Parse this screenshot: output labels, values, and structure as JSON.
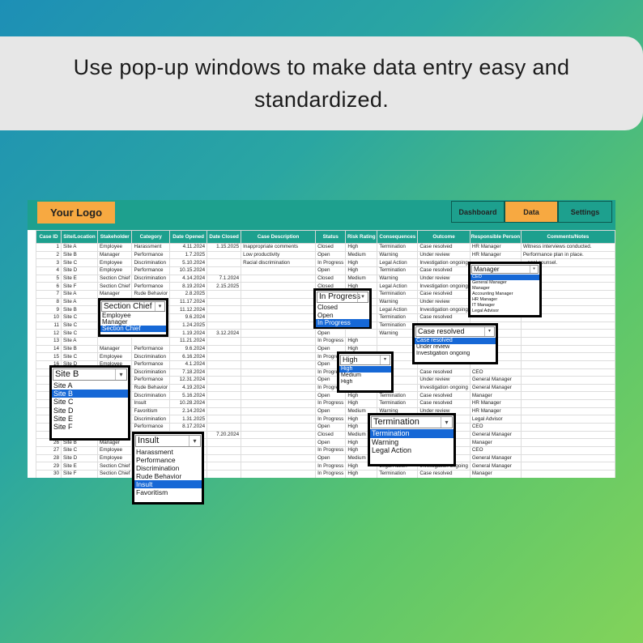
{
  "headline": {
    "line1": "Use pop-up windows to make data entry easy and",
    "line2": "standardized."
  },
  "toolbar": {
    "logo": "Your Logo",
    "tabs": [
      {
        "label": "Dashboard",
        "active": false
      },
      {
        "label": "Data",
        "active": true
      },
      {
        "label": "Settings",
        "active": false
      }
    ]
  },
  "colors": {
    "header_teal": "#1da08e",
    "accent_orange": "#f7a941",
    "highlight_blue": "#1668d6"
  },
  "table": {
    "headers": [
      "Case ID",
      "Site/Location",
      "Stakeholder",
      "Category",
      "Date Opened",
      "Date Closed",
      "Case Description",
      "Status",
      "Risk Rating",
      "Consequences",
      "Outcome",
      "Responsible Person",
      "Comments/Notes"
    ],
    "rows": [
      [
        "1",
        "Site A",
        "Employee",
        "Harassment",
        "4.11.2024",
        "1.15.2025",
        "Inappropriate comments",
        "Closed",
        "High",
        "Termination",
        "Case resolved",
        "HR Manager",
        "Witness interviews conducted."
      ],
      [
        "2",
        "Site B",
        "Manager",
        "Performance",
        "1.7.2025",
        "",
        "Low productivity",
        "Open",
        "Medium",
        "Warning",
        "Under review",
        "HR Manager",
        "Performance plan in place."
      ],
      [
        "3",
        "Site C",
        "Employee",
        "Discrimination",
        "5.10.2024",
        "",
        "Racial discrimination",
        "In Progress",
        "High",
        "Legal Action",
        "Investigation ongoing",
        "",
        "...egal counsel."
      ],
      [
        "4",
        "Site D",
        "Employee",
        "Performance",
        "10.15.2024",
        "",
        "",
        "Open",
        "High",
        "Termination",
        "Case resolved",
        "",
        ""
      ],
      [
        "5",
        "Site E",
        "Section Chief",
        "Discrimination",
        "4.14.2024",
        "7.1.2024",
        "",
        "Closed",
        "Medium",
        "Warning",
        "Under review",
        "",
        ""
      ],
      [
        "6",
        "Site F",
        "Section Chief",
        "Performance",
        "8.19.2024",
        "2.15.2025",
        "",
        "Closed",
        "High",
        "Legal Action",
        "Investigation ongoing",
        "",
        ""
      ],
      [
        "7",
        "Site A",
        "Manager",
        "Rude Behavior",
        "2.8.2025",
        "",
        "",
        "Closed",
        "",
        "Termination",
        "Case resolved",
        "",
        ""
      ],
      [
        "8",
        "Site A",
        "",
        "",
        "11.17.2024",
        "",
        "",
        "",
        "",
        "Warning",
        "Under review",
        "",
        ""
      ],
      [
        "9",
        "Site B",
        "",
        "",
        "11.12.2024",
        "",
        "",
        "",
        "",
        "Legal Action",
        "Investigation ongoing",
        "",
        ""
      ],
      [
        "10",
        "Site C",
        "",
        "",
        "9.6.2024",
        "",
        "",
        "",
        "",
        "Termination",
        "Case resolved",
        "",
        ""
      ],
      [
        "11",
        "Site C",
        "",
        "",
        "1.24.2025",
        "",
        "",
        "",
        "",
        "Termination",
        "",
        "",
        ""
      ],
      [
        "12",
        "Site C",
        "",
        "",
        "1.19.2024",
        "3.12.2024",
        "",
        "Open",
        "",
        "Warning",
        "",
        "",
        ""
      ],
      [
        "13",
        "Site A",
        "",
        "",
        "11.21.2024",
        "",
        "",
        "In Progress",
        "High",
        "",
        "",
        "",
        ""
      ],
      [
        "14",
        "Site B",
        "Manager",
        "Performance",
        "9.6.2024",
        "",
        "",
        "Open",
        "High",
        "",
        "",
        "",
        ""
      ],
      [
        "15",
        "Site C",
        "Employee",
        "Discrimination",
        "6.16.2024",
        "",
        "",
        "In Progress",
        "",
        "",
        "",
        "",
        ""
      ],
      [
        "16",
        "Site D",
        "Employee",
        "Performance",
        "4.1.2024",
        "",
        "",
        "Open",
        "",
        "",
        "",
        "",
        ""
      ],
      [
        "17",
        "",
        "",
        "Discrimination",
        "7.18.2024",
        "",
        "",
        "In Progress",
        "",
        "",
        "Case resolved",
        "CEO",
        ""
      ],
      [
        "18",
        "",
        "",
        "Performance",
        "12.31.2024",
        "",
        "",
        "Open",
        "",
        "",
        "Under review",
        "General Manager",
        ""
      ],
      [
        "19",
        "",
        "",
        "Rude Behavior",
        "4.19.2024",
        "",
        "",
        "In Progress",
        "",
        "",
        "Investigation ongoing",
        "General Manager",
        ""
      ],
      [
        "20",
        "",
        "",
        "Discrimination",
        "5.16.2024",
        "",
        "",
        "Open",
        "High",
        "Termination",
        "Case resolved",
        "Manager",
        ""
      ],
      [
        "21",
        "",
        "",
        "Insult",
        "10.28.2024",
        "",
        "",
        "In Progress",
        "High",
        "Termination",
        "Case resolved",
        "HR Manager",
        ""
      ],
      [
        "22",
        "",
        "",
        "Favoritism",
        "2.14.2024",
        "",
        "",
        "Open",
        "Medium",
        "Warning",
        "Under review",
        "HR Manager",
        ""
      ],
      [
        "23",
        "",
        "",
        "Discrimination",
        "1.31.2025",
        "",
        "",
        "In Progress",
        "High",
        "",
        "",
        "Legal Advisor",
        ""
      ],
      [
        "24",
        "",
        "",
        "Performance",
        "8.17.2024",
        "",
        "",
        "Open",
        "High",
        "",
        "",
        "CEO",
        ""
      ],
      [
        "25",
        "",
        "",
        "",
        "",
        "7.20.2024",
        "",
        "Closed",
        "Medium",
        "",
        "",
        "General Manager",
        ""
      ],
      [
        "26",
        "Site B",
        "Manager",
        "",
        "",
        "",
        "",
        "Open",
        "High",
        "",
        "",
        "Manager",
        ""
      ],
      [
        "27",
        "Site C",
        "Employee",
        "",
        "",
        "",
        "",
        "In Progress",
        "High",
        "",
        "",
        "CEO",
        ""
      ],
      [
        "28",
        "Site D",
        "Employee",
        "",
        "",
        "",
        "",
        "Open",
        "Medium",
        "",
        "",
        "General Manager",
        ""
      ],
      [
        "29",
        "Site E",
        "Section Chief",
        "",
        "",
        "",
        "",
        "In Progress",
        "High",
        "Legal Action",
        "Investigation ongoing",
        "General Manager",
        ""
      ],
      [
        "30",
        "Site F",
        "Section Chief",
        "",
        "",
        "",
        "",
        "In Progress",
        "High",
        "Termination",
        "Case resolved",
        "Manager",
        ""
      ]
    ]
  },
  "dropdowns": {
    "stakeholder": {
      "selected": "Section Chief",
      "options": [
        "Employee",
        "Manager",
        "Section Chief"
      ],
      "highlighted": 2
    },
    "site": {
      "selected": "Site B",
      "options": [
        "Site A",
        "Site B",
        "Site C",
        "Site D",
        "Site E",
        "Site F"
      ],
      "highlighted": 1
    },
    "category": {
      "selected": "Insult",
      "options": [
        "Harassment",
        "Performance",
        "Discrimination",
        "Rude Behavior",
        "Insult",
        "Favoritism"
      ],
      "highlighted": 4
    },
    "status": {
      "selected": "In Progress",
      "options": [
        "Closed",
        "Open",
        "In Progress"
      ],
      "highlighted": 2
    },
    "risk": {
      "selected": "High",
      "options": [
        "High",
        "Medium",
        "High"
      ],
      "highlighted": 0
    },
    "consequences": {
      "selected": "Termination",
      "options": [
        "Termination",
        "Warning",
        "Legal Action"
      ],
      "highlighted": 0
    },
    "outcome": {
      "selected": "Case resolved",
      "options": [
        "Case resolved",
        "Under review",
        "Investigation ongoing"
      ],
      "highlighted": 0
    },
    "responsible": {
      "selected": "Manager",
      "options": [
        "CEO",
        "General Manager",
        "Manager",
        "Accounting Manager",
        "HR Manager",
        "IT Manager",
        "Legal Advisor"
      ],
      "highlighted": 0
    }
  }
}
